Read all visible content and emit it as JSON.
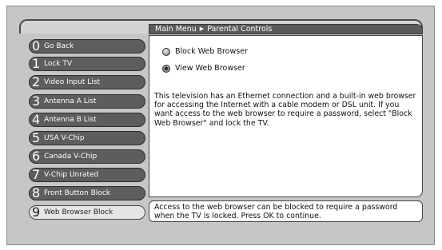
{
  "breadcrumb": {
    "root": "Main Menu",
    "separator": "▶",
    "current": "Parental Controls"
  },
  "menu": [
    {
      "num": "0",
      "label": "Go Back"
    },
    {
      "num": "1",
      "label": "Lock TV"
    },
    {
      "num": "2",
      "label": "Video Input List"
    },
    {
      "num": "3",
      "label": "Antenna A List"
    },
    {
      "num": "4",
      "label": "Antenna B List"
    },
    {
      "num": "5",
      "label": "USA V-Chip"
    },
    {
      "num": "6",
      "label": "Canada V-Chip"
    },
    {
      "num": "7",
      "label": "V-Chip Unrated"
    },
    {
      "num": "8",
      "label": "Front Button Block"
    },
    {
      "num": "9",
      "label": "Web Browser Block"
    }
  ],
  "selected_menu_index": 9,
  "options": [
    {
      "label": "Block Web Browser",
      "selected": false
    },
    {
      "label": "View Web Browser",
      "selected": true
    }
  ],
  "description": "This television has an Ethernet connection and a built-in web browser for accessing the Internet with a cable modem or DSL unit.  If you want access to the web browser to require a password, select \"Block Web Browser\" and lock the TV.",
  "help_text": "Access to the web browser can be blocked to require a password when the TV is locked. Press OK to continue.",
  "colors": {
    "background": "#c6c6c6",
    "menu_button": "#5d5d5d",
    "menu_selected": "#e6e6e6",
    "breadcrumb_bar": "#5a5a5a",
    "panel": "#ffffff"
  }
}
